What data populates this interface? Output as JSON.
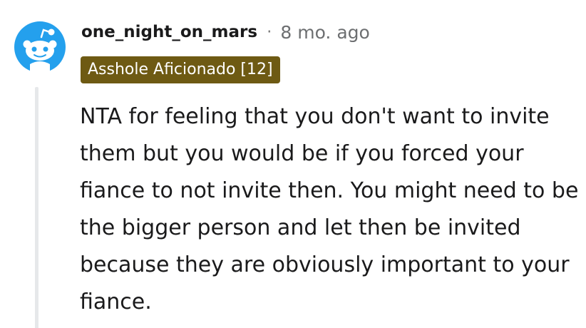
{
  "comment": {
    "author": "one_night_on_mars",
    "separator": "·",
    "timestamp": "8 mo. ago",
    "flair": "Asshole Aficionado [12]",
    "body": "NTA for feeling that you don't want to invite them but you would be if you forced your fiance to not invite then. You might need to be the bigger person and let then be invited because they are obviously important to your fiance."
  },
  "avatar": {
    "icon": "reddit-snoo-icon",
    "background_color": "#24a0ed"
  },
  "colors": {
    "flair_background": "#6e5a13",
    "flair_text": "#ffffff",
    "thread_line": "#e6e8ea",
    "meta_text": "#6d6f71"
  }
}
